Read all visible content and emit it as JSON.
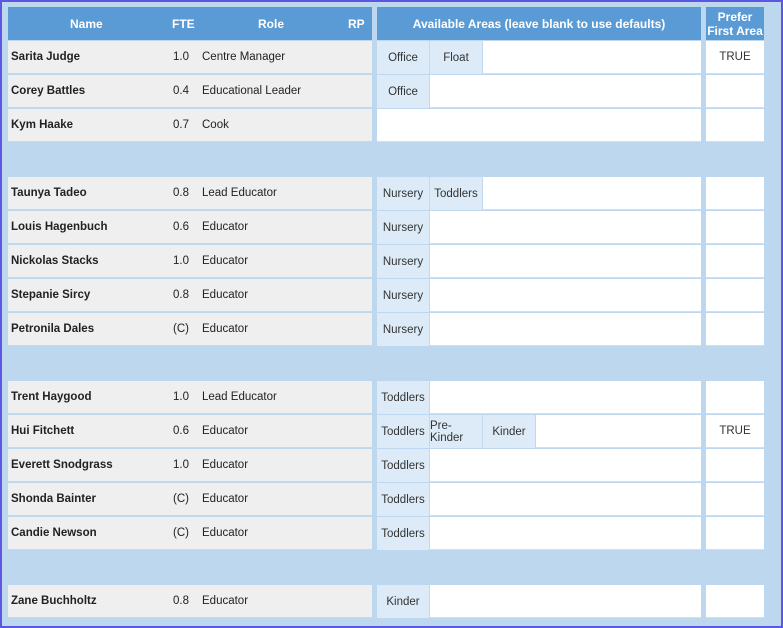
{
  "headers": {
    "name": "Name",
    "fte": "FTE",
    "role": "Role",
    "rp": "RP",
    "areas": "Available Areas (leave blank to use defaults)",
    "prefer_line1": "Prefer",
    "prefer_line2": "First Area"
  },
  "groups": [
    {
      "rows": [
        {
          "name": "Sarita Judge",
          "fte": "1.0",
          "role": "Centre Manager",
          "areas": [
            "Office",
            "Float"
          ],
          "prefer": "TRUE"
        },
        {
          "name": "Corey Battles",
          "fte": "0.4",
          "role": "Educational Leader",
          "areas": [
            "Office"
          ],
          "prefer": ""
        },
        {
          "name": "Kym Haake",
          "fte": "0.7",
          "role": "Cook",
          "areas": [],
          "prefer": ""
        }
      ]
    },
    {
      "rows": [
        {
          "name": "Taunya Tadeo",
          "fte": "0.8",
          "role": "Lead Educator",
          "areas": [
            "Nursery",
            "Toddlers"
          ],
          "prefer": ""
        },
        {
          "name": "Louis Hagenbuch",
          "fte": "0.6",
          "role": "Educator",
          "areas": [
            "Nursery"
          ],
          "prefer": ""
        },
        {
          "name": "Nickolas Stacks",
          "fte": "1.0",
          "role": "Educator",
          "areas": [
            "Nursery"
          ],
          "prefer": ""
        },
        {
          "name": "Stepanie Sircy",
          "fte": "0.8",
          "role": "Educator",
          "areas": [
            "Nursery"
          ],
          "prefer": ""
        },
        {
          "name": "Petronila Dales",
          "fte": "(C)",
          "role": "Educator",
          "areas": [
            "Nursery"
          ],
          "prefer": ""
        }
      ]
    },
    {
      "rows": [
        {
          "name": "Trent Haygood",
          "fte": "1.0",
          "role": "Lead Educator",
          "areas": [
            "Toddlers"
          ],
          "prefer": ""
        },
        {
          "name": "Hui Fitchett",
          "fte": "0.6",
          "role": "Educator",
          "areas": [
            "Toddlers",
            "Pre-Kinder",
            "Kinder"
          ],
          "prefer": "TRUE"
        },
        {
          "name": "Everett Snodgrass",
          "fte": "1.0",
          "role": "Educator",
          "areas": [
            "Toddlers"
          ],
          "prefer": ""
        },
        {
          "name": "Shonda Bainter",
          "fte": "(C)",
          "role": "Educator",
          "areas": [
            "Toddlers"
          ],
          "prefer": ""
        },
        {
          "name": "Candie Newson",
          "fte": "(C)",
          "role": "Educator",
          "areas": [
            "Toddlers"
          ],
          "prefer": ""
        }
      ]
    },
    {
      "rows": [
        {
          "name": "Zane Buchholtz",
          "fte": "0.8",
          "role": "Educator",
          "areas": [
            "Kinder"
          ],
          "prefer": ""
        }
      ]
    }
  ]
}
